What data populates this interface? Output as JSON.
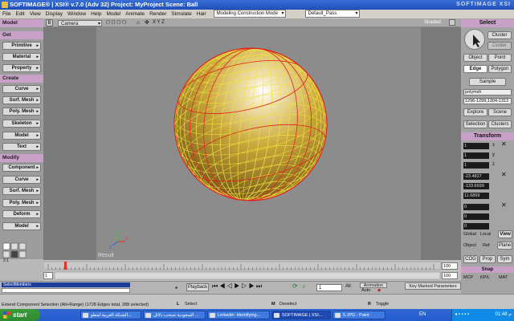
{
  "window": {
    "title": "SOFTIMAGE® | XSI® v.7.0 (Adv 32) Project: MyProject    Scene: Ball",
    "brand": "SOFTIMAGE XSI"
  },
  "menu": {
    "items": [
      "File",
      "Edit",
      "View",
      "Display",
      "Window",
      "Help",
      "Model",
      "Animate",
      "Render",
      "Simulate",
      "Hair"
    ],
    "mode": "Modeling Construction Mode",
    "pass": "Default_Pass"
  },
  "left_panel": {
    "tab": "Model",
    "sections": {
      "get": {
        "label": "Get",
        "buttons": [
          "Primitive",
          "Material",
          "Property"
        ]
      },
      "create": {
        "label": "Create",
        "buttons": [
          "Curve",
          "Surf. Mesh",
          "Poly. Mesh",
          "Skeleton",
          "Model",
          "Text"
        ]
      },
      "modify": {
        "label": "Modify",
        "buttons": [
          "Component",
          "Curve",
          "Surf. Mesh",
          "Poly. Mesh",
          "Deform",
          "Model"
        ]
      }
    },
    "grid_labels": [
      "2:1",
      "1"
    ]
  },
  "viewport": {
    "camera": "Camera",
    "axes": "X Y Z",
    "shading": "Shaded",
    "result_label": "Result",
    "sphere_color": "#c9a83a",
    "wire_color": "#f0e040",
    "selected_edge_color": "#e02020"
  },
  "right_panel": {
    "select_header": "Select",
    "buttons": {
      "cluster": "Cluster",
      "center": "Center",
      "object": "Object",
      "point": "Point",
      "edge": "Edge",
      "polygon": "Polygon",
      "sample": "Sample",
      "explore": "Explore",
      "scene": "Scene",
      "selection": "Selection",
      "clusters": "Clusters"
    },
    "name_field": "polymsh",
    "range_field": "1296-1299,1304-1312",
    "transform_header": "Transform",
    "scale": {
      "x": "1",
      "y": "1",
      "z": "1"
    },
    "rotate": {
      "x": "-23.4827",
      "y": "-133.6699",
      "z": "11.6869"
    },
    "translate": {
      "x": "0",
      "y": "0",
      "z": "0"
    },
    "axis_letters": [
      "x",
      "y",
      "z"
    ],
    "space": {
      "global": "Global",
      "local": "Local",
      "view": "View"
    },
    "ref": {
      "object": "Object",
      "ref": "Ref",
      "plane": "Plane"
    },
    "bottom": {
      "cog": "COG",
      "prop": "Prop",
      "sym": "Sym"
    },
    "misc": {
      "mcp": "MCP",
      "kpl": "KP/L",
      "mat": "MAT"
    },
    "snap": "Snap"
  },
  "timeline": {
    "start": "1",
    "end": "100",
    "end2": "100",
    "current": "1",
    "ticks": [
      "2",
      "10",
      "20",
      "30",
      "40",
      "50",
      "60",
      "70",
      "80",
      "90",
      "100"
    ]
  },
  "playbar": {
    "playback": "Playback",
    "frame": "1",
    "all": "All",
    "animation": "Animation",
    "auto": "Auto",
    "key_marked": "Key Marked Parameters",
    "cmd_input": "SelectMembers"
  },
  "status": {
    "message": "Extend Component Selection (Alt+Range) (1728 Edges total, 288 selected)",
    "select": "Select",
    "deselect": "Deselect",
    "toggle": "Toggle",
    "mouse": [
      "L",
      "M",
      "R"
    ]
  },
  "taskbar": {
    "start": "start",
    "tasks": [
      "الشبكة العربية لمطو...",
      "السعودية تسحب دلائل ...",
      "Linkedin: Identifying...",
      "SOFTIMAGE | XSI...",
      "5.JPG - Paint"
    ],
    "lang": "EN",
    "clock": "01:48 م"
  }
}
